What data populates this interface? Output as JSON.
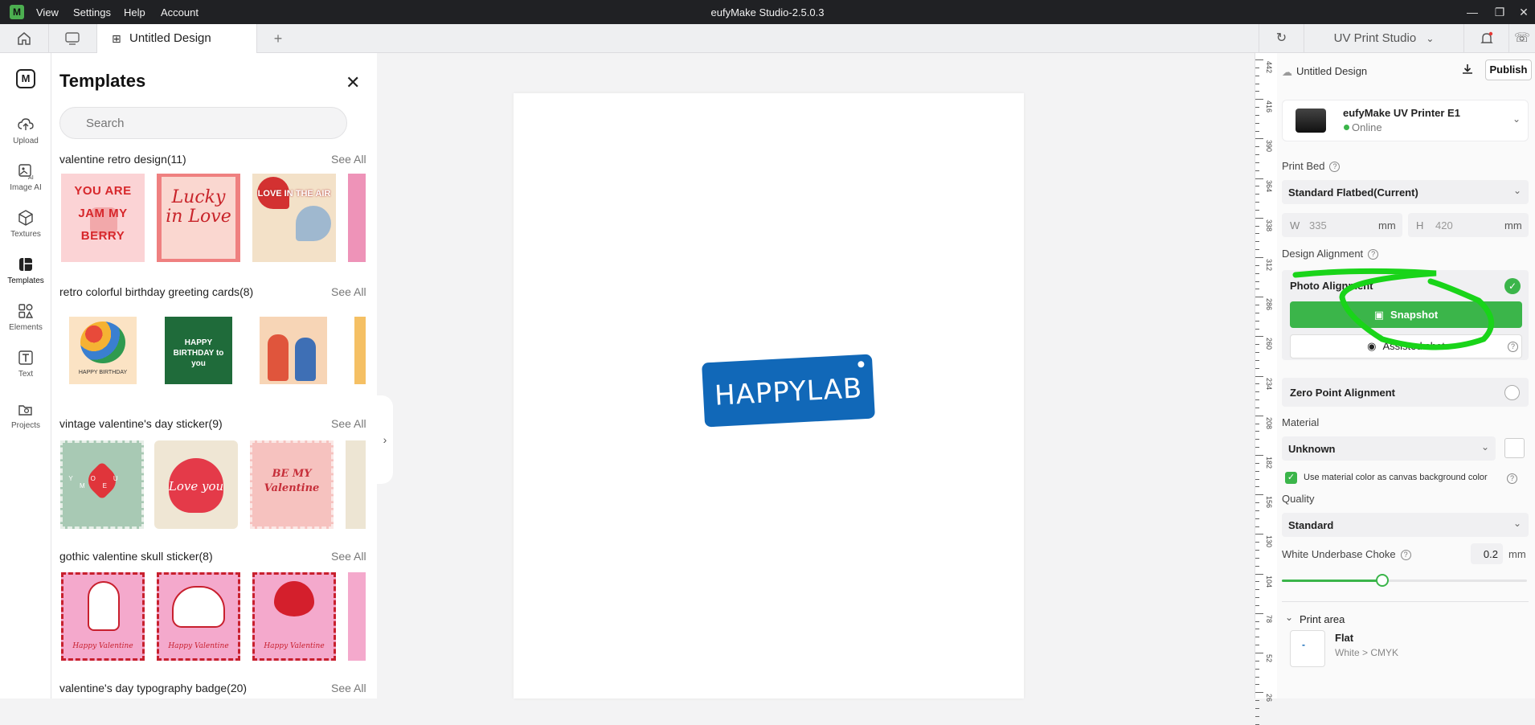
{
  "window": {
    "title": "eufyMake Studio-2.5.0.3",
    "menu": [
      "View",
      "Settings",
      "Help",
      "Account"
    ]
  },
  "tabs": {
    "active_label": "Untitled Design",
    "studio_label": "UV Print Studio"
  },
  "sidebar": {
    "items": [
      {
        "label": "Upload",
        "icon": "upload-cloud-icon"
      },
      {
        "label": "Image AI",
        "icon": "image-ai-icon"
      },
      {
        "label": "Textures",
        "icon": "cube-icon"
      },
      {
        "label": "Templates",
        "icon": "templates-icon"
      },
      {
        "label": "Elements",
        "icon": "elements-icon"
      },
      {
        "label": "Text",
        "icon": "text-icon"
      },
      {
        "label": "Projects",
        "icon": "projects-icon"
      }
    ]
  },
  "templates": {
    "title": "Templates",
    "search_placeholder": "Search",
    "see_all": "See All",
    "sections": [
      {
        "title": "valentine retro design(11)",
        "thumbs": [
          "YOU ARE JAM MY BERRY",
          "Lucky in Love",
          "LOVE IN THE AIR",
          ""
        ]
      },
      {
        "title": "retro colorful birthday greeting cards(8)",
        "thumbs": [
          "HAPPY BIRTHDAY",
          "HAPPY BIRTHDAY to you",
          "",
          ""
        ]
      },
      {
        "title": "vintage valentine's day sticker(9)",
        "thumbs": [
          "YOU ME",
          "Love you",
          "BE MY Valentine",
          ""
        ]
      },
      {
        "title": "gothic valentine skull sticker(8)",
        "thumbs": [
          "Happy Valentine",
          "Happy Valentine",
          "Happy Valentine",
          ""
        ]
      },
      {
        "title": "valentine's day typography badge(20)",
        "thumbs": []
      }
    ]
  },
  "canvas": {
    "sticker_text": "HAPPYLAB"
  },
  "ruler": {
    "labels": [
      "442",
      "416",
      "390",
      "364",
      "338",
      "312",
      "286",
      "260",
      "234",
      "208",
      "182",
      "156",
      "130",
      "104",
      "78",
      "52",
      "26"
    ]
  },
  "right_panel": {
    "design_name": "Untitled Design",
    "publish_label": "Publish",
    "printer": {
      "name": "eufyMake UV Printer E1",
      "status": "Online"
    },
    "print_bed_label": "Print Bed",
    "print_bed_value": "Standard Flatbed(Current)",
    "width_label": "W",
    "width_value": "335",
    "height_label": "H",
    "height_value": "420",
    "unit": "mm",
    "design_alignment_label": "Design Alignment",
    "photo_alignment_label": "Photo Alignment",
    "snapshot_label": "Snapshot",
    "assisted_shot_label": "Assisted shot",
    "zero_point_label": "Zero Point Alignment",
    "material_label": "Material",
    "material_value": "Unknown",
    "use_material_color_label": "Use material color as canvas background color",
    "quality_label": "Quality",
    "quality_value": "Standard",
    "white_underbase_label": "White Underbase Choke",
    "white_underbase_value": "0.2",
    "white_underbase_fraction": 0.41,
    "print_area_label": "Print area",
    "print_area_mode": "Flat",
    "print_area_sub": "White > CMYK",
    "print_area_thumb": "-"
  },
  "colors": {
    "accent_green": "#3bb54a",
    "sticker_blue": "#1168b8",
    "annotation_green": "#19d419"
  }
}
